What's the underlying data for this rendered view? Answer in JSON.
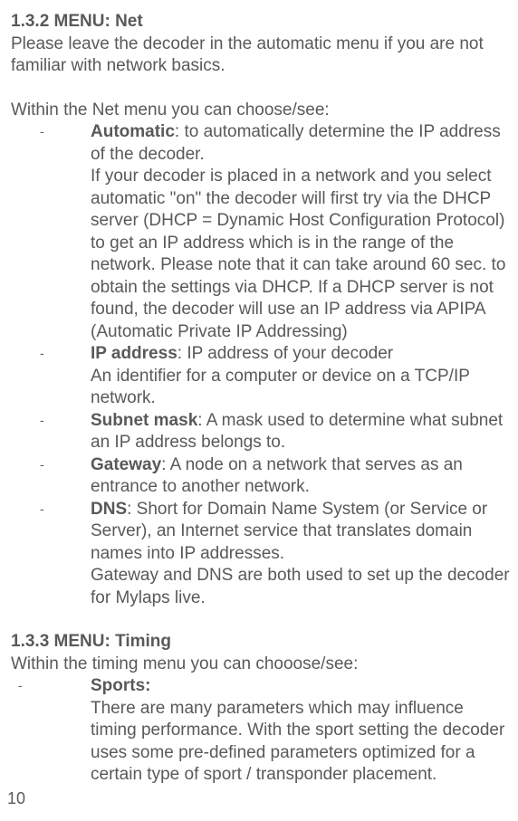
{
  "section1": {
    "heading": "1.3.2 MENU: Net",
    "intro": "Please leave the decoder in the automatic menu if you are not familiar with network basics.",
    "lead": "Within the Net menu you can choose/see:",
    "items": [
      {
        "title": "Automatic",
        "titleSuffix": ": to automatically determine the IP address of the decoder.",
        "body": "If your decoder is placed in a network and you select automatic \"on\" the decoder will first try via the DHCP server (DHCP = Dynamic Host Configuration Protocol) to get an IP address which is in the range of the network. Please note that it can take around 60 sec. to obtain the settings via DHCP. If a DHCP server is not found, the decoder will use an IP address via APIPA (Automatic Private IP Addressing)"
      },
      {
        "title": "IP address",
        "titleSuffix": ": IP address of your decoder",
        "body": "An identifier for a computer or device on a TCP/IP network."
      },
      {
        "title": "Subnet mask",
        "titleSuffix": ": A mask used to determine what subnet an IP address belongs to.",
        "body": ""
      },
      {
        "title": "Gateway",
        "titleSuffix": ": A node on a network that serves as an entrance to another network.",
        "body": ""
      },
      {
        "title": "DNS",
        "titleSuffix": ": Short for Domain Name System (or Service or Server), an Internet service that translates domain names into IP addresses.",
        "body": "Gateway and DNS are both used to set up the decoder for Mylaps live."
      }
    ]
  },
  "section2": {
    "heading": "1.3.3 MENU: Timing",
    "lead": "Within the timing menu you can chooose/see:",
    "items": [
      {
        "title": "Sports:",
        "body": "There are many parameters which may influence timing performance. With the sport setting the decoder uses some pre-defined parameters optimized for a certain type of sport / transponder placement."
      }
    ]
  },
  "pageNumber": "10",
  "dash": "-"
}
